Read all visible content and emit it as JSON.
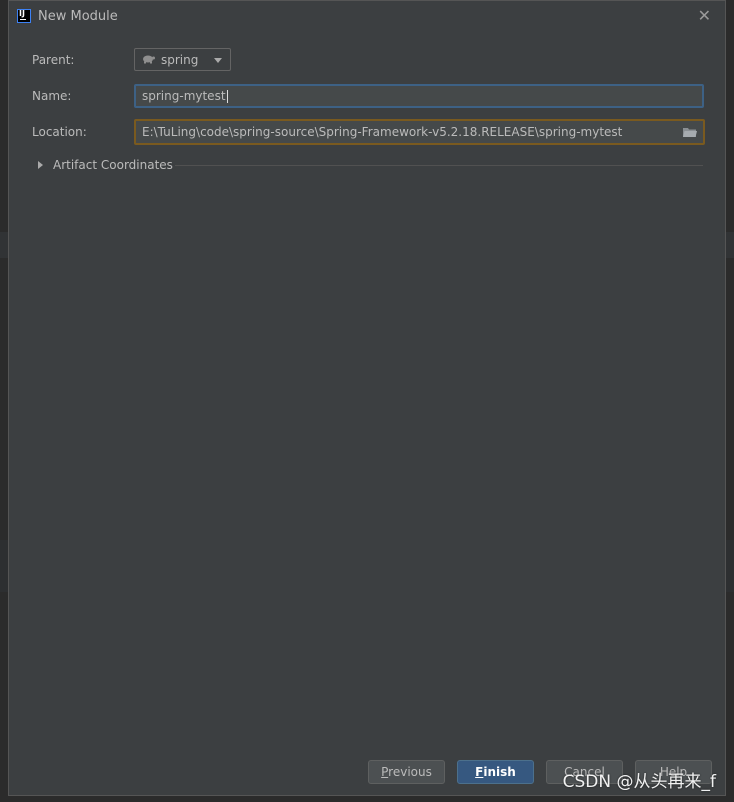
{
  "dialog": {
    "title": "New Module",
    "close_glyph": "✕"
  },
  "form": {
    "parent_label": "Parent:",
    "parent_value": "spring",
    "name_label": "Name:",
    "name_value": "spring-mytest",
    "location_label": "Location:",
    "location_value": "E:\\TuLing\\code\\spring-source\\Spring-Framework-v5.2.18.RELEASE\\spring-mytest"
  },
  "artifact_coordinates": {
    "label": "Artifact Coordinates",
    "expanded": false
  },
  "buttons": {
    "previous_mnemonic": "P",
    "previous_rest": "revious",
    "finish_mnemonic": "F",
    "finish_rest": "inish",
    "cancel_label": "Cancel",
    "help_label": "Help"
  },
  "watermark": "CSDN @从头再来_f",
  "icons": {
    "app": "intellij-idea-icon",
    "module": "turtle-module-icon",
    "dropdown": "chevron-down-icon",
    "browse": "folder-icon",
    "expand": "triangle-right-icon"
  },
  "colors": {
    "dialog_bg": "#3c3f41",
    "field_bg": "#45494a",
    "focus_border": "#3d6185",
    "warning_border": "#7a5a1f",
    "primary_button": "#365880"
  }
}
